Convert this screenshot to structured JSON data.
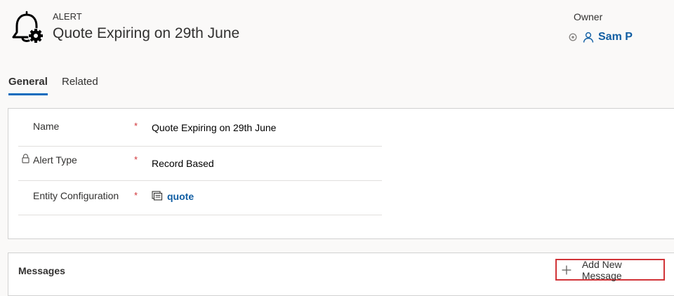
{
  "header": {
    "entity_type": "ALERT",
    "title": "Quote Expiring on 29th June",
    "owner_label": "Owner",
    "owner_name": "Sam P"
  },
  "tabs": [
    {
      "label": "General",
      "selected": true
    },
    {
      "label": "Related",
      "selected": false
    }
  ],
  "general": {
    "fields": [
      {
        "label": "Name",
        "required": "*",
        "value": "Quote Expiring on 29th June"
      },
      {
        "label": "Alert Type",
        "required": "*",
        "value": "Record Based",
        "locked": true
      },
      {
        "label": "Entity Configuration",
        "required": "*",
        "value": "quote",
        "lookup": true
      }
    ]
  },
  "messages": {
    "title": "Messages",
    "add_label": "Add New Message"
  },
  "icons": {
    "entity": "bell-gear-icon",
    "owner_status": "status-circle-icon",
    "owner": "person-icon",
    "lock": "lock-icon",
    "lookup": "entity-lookup-icon",
    "add": "plus-icon"
  },
  "colors": {
    "link": "#115ea3",
    "accent": "#0f6cbd",
    "required": "#d13438",
    "highlight": "#d13438"
  }
}
